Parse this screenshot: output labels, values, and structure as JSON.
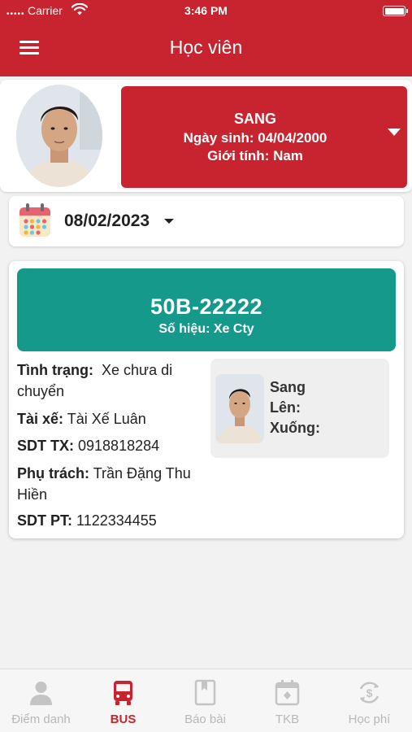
{
  "status_bar": {
    "carrier": "Carrier",
    "time": "3:46 PM"
  },
  "header": {
    "title": "Học viên"
  },
  "student": {
    "name": "SANG",
    "dob_line": "Ngày sinh: 04/04/2000",
    "gender_line": "Giới tính: Nam"
  },
  "date_picker": {
    "value": "08/02/2023"
  },
  "bus": {
    "plate": "50B-22222",
    "code_line": "Số hiệu: Xe Cty",
    "status_label": "Tình trạng:",
    "status_value": "Xe chưa di chuyển",
    "driver_label": "Tài xế:",
    "driver_value": "Tài Xế Luân",
    "driver_phone_label": "SDT TX:",
    "driver_phone_value": "0918818284",
    "supervisor_label": "Phụ trách:",
    "supervisor_value": "Trần Đặng Thu Hiền",
    "supervisor_phone_label": "SDT PT:",
    "supervisor_phone_value": "1122334455"
  },
  "student_mini": {
    "name": "Sang",
    "up_label": "Lên:",
    "down_label": "Xuống:"
  },
  "tabbar": {
    "tabs": [
      {
        "label": "Điểm danh",
        "icon": "person-icon"
      },
      {
        "label": "BUS",
        "icon": "bus-icon"
      },
      {
        "label": "Báo bài",
        "icon": "book-icon"
      },
      {
        "label": "TKB",
        "icon": "timetable-icon"
      },
      {
        "label": "Học phí",
        "icon": "tuition-icon"
      }
    ],
    "active_index": 1
  },
  "colors": {
    "brand_red": "#c8242f",
    "plate_teal": "#14998a",
    "inactive_tab": "#b8b8b8"
  }
}
